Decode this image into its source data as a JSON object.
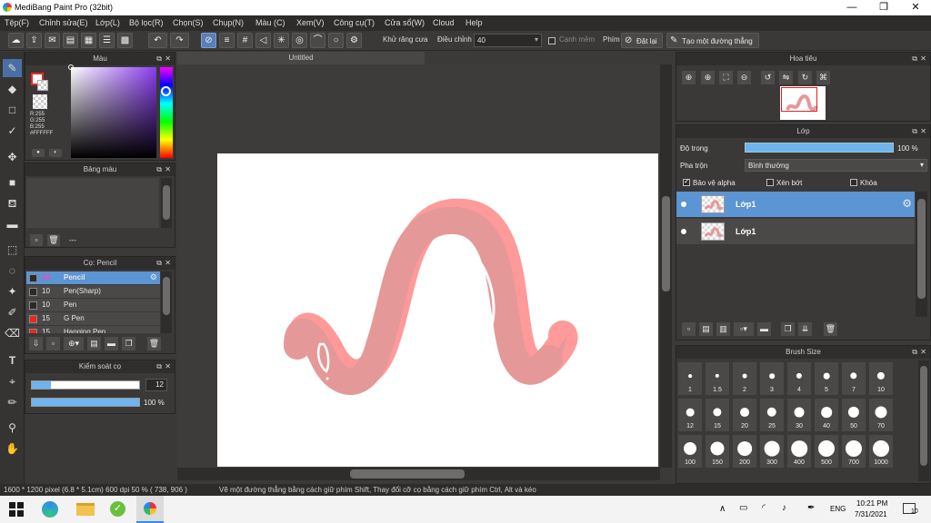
{
  "window": {
    "title": "MediBang Paint Pro (32bit)",
    "minimize": "—",
    "maximize": "❐",
    "close": "✕"
  },
  "menu": [
    "Tệp(F)",
    "Chỉnh sửa(E)",
    "Lớp(L)",
    "Bộ lọc(R)",
    "Chọn(S)",
    "Chụp(N)",
    "Màu (C)",
    "Xem(V)",
    "Công cụ(T)",
    "Cửa sổ(W)",
    "Cloud",
    "Help"
  ],
  "toolbar": {
    "antialias_label": "Khử răng cưa",
    "adjust_label": "Điều chỉnh",
    "adjust_value": "40",
    "edge_label": "Cạnh mềm",
    "key_label": "Phím",
    "reset_label": "Đặt lại",
    "straight_line_label": "Tạo một đường thẳng"
  },
  "color_panel": {
    "title": "Màu",
    "readout": [
      "R:255",
      "G:255",
      "B:255",
      "#FFFFFF"
    ],
    "primary": "#ffffff",
    "secondary": "#e8291f"
  },
  "palette_panel": {
    "title": "Bảng màu",
    "dash": "---"
  },
  "brush_panel": {
    "title": "Cọ: Pencil",
    "items": [
      {
        "size": "12",
        "name": "Pencil",
        "color": "#2a2a2a",
        "selected": true
      },
      {
        "size": "10",
        "name": "Pen(Sharp)",
        "color": "#2a2a2a",
        "selected": false
      },
      {
        "size": "10",
        "name": "Pen",
        "color": "#2a2a2a",
        "selected": false
      },
      {
        "size": "15",
        "name": "G Pen",
        "color": "#e8291f",
        "selected": false
      },
      {
        "size": "15",
        "name": "Hanging Pen",
        "color": "#e8291f",
        "selected": false
      }
    ]
  },
  "brush_control": {
    "title": "Kiểm soát cọ",
    "size_value": "12",
    "size_fraction": 0.18,
    "opacity_label": "100 %",
    "opacity_fraction": 1.0
  },
  "document": {
    "tab": "Untitled"
  },
  "navigator": {
    "title": "Hoa tiêu"
  },
  "layer_panel": {
    "title": "Lớp",
    "opacity_label": "Độ trong",
    "opacity_value": "100 %",
    "blend_label": "Pha trộn",
    "blend_value": "Bình thường",
    "protect_alpha": "Bảo vệ alpha",
    "clipping": "Xén bớt",
    "lock": "Khóa",
    "layers": [
      {
        "name": "Lớp1",
        "selected": true
      },
      {
        "name": "Lớp1",
        "selected": false
      }
    ]
  },
  "brush_size_panel": {
    "title": "Brush Size",
    "sizes": [
      "1",
      "1.5",
      "2",
      "3",
      "4",
      "5",
      "7",
      "10",
      "12",
      "15",
      "20",
      "25",
      "30",
      "40",
      "50",
      "70",
      "100",
      "150",
      "200",
      "300",
      "400",
      "500",
      "700",
      "1000"
    ]
  },
  "status": {
    "doc_info": "1600 * 1200 pixel   (6.8 * 5.1cm)   600 dpi   50 %   ( 738, 906 )",
    "hint": "Vẽ một đường thẳng bằng cách giữ phím Shift, Thay đổi cỡ cọ bằng cách giữ phím Ctrl, Alt và kéo"
  },
  "taskbar": {
    "lang": "ENG",
    "time": "10:21 PM",
    "date": "7/31/2021",
    "notif": "10"
  },
  "colors": {
    "accent": "#4f8fd0",
    "stroke_dark": "#e89a9a",
    "stroke_light": "#ff9a9a"
  }
}
